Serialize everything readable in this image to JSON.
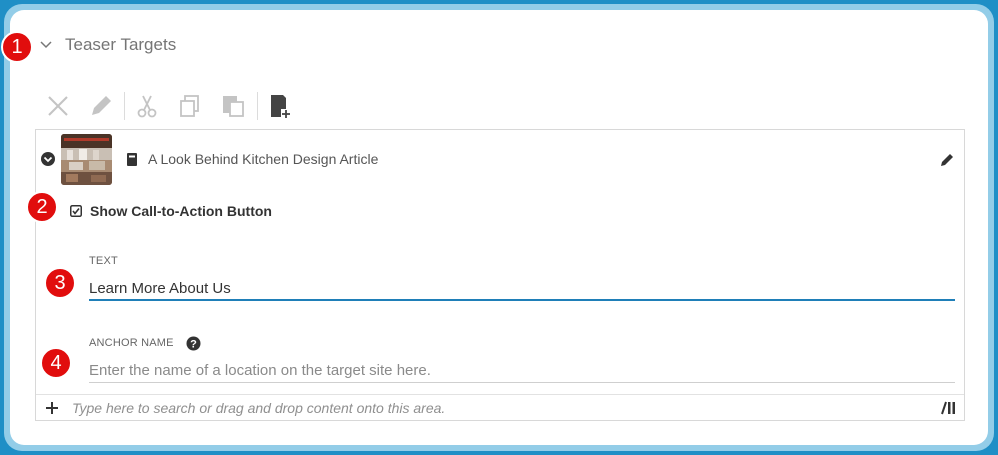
{
  "section": {
    "title": "Teaser Targets"
  },
  "markers": [
    "1",
    "2",
    "3",
    "4"
  ],
  "item": {
    "title": "A Look Behind Kitchen Design Article"
  },
  "cta": {
    "checkbox_label": "Show Call-to-Action Button",
    "checked": true
  },
  "text_field": {
    "label": "TEXT",
    "value": "Learn More About Us"
  },
  "anchor_field": {
    "label": "ANCHOR NAME",
    "placeholder": "Enter the name of a location on the target site here."
  },
  "footer": {
    "placeholder": "Type here to search or drag and drop content onto this area."
  },
  "colors": {
    "frame_outer": "#1f8fc6",
    "frame_inner": "#93cde8",
    "marker": "#e10d0d",
    "focus_underline": "#1f7fb8"
  },
  "icons": [
    "chevron-down-icon",
    "remove-icon",
    "edit-icon",
    "cut-icon",
    "copy-icon",
    "paste-icon",
    "add-document-icon",
    "expand-circle-icon",
    "article-icon",
    "checkbox-icon",
    "help-icon",
    "plus-icon",
    "library-icon"
  ]
}
